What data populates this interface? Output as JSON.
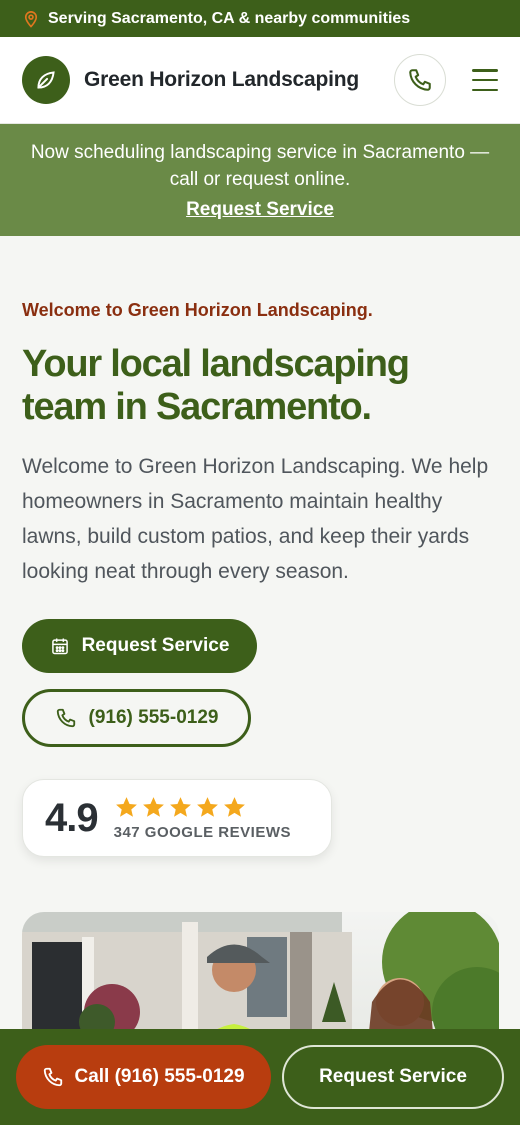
{
  "topbar": {
    "location_text": "Serving Sacramento, CA & nearby communities"
  },
  "header": {
    "brand": "Green Horizon Landscaping"
  },
  "announcement": {
    "text": "Now scheduling landscaping service in Sacramento — call or request online.",
    "link_label": "Request Service"
  },
  "hero": {
    "eyebrow": "Welcome to Green Horizon Landscaping.",
    "headline": "Your local landscaping team in Sacramento.",
    "lede": "Welcome to Green Horizon Landscaping. We help homeowners in Sacramento maintain healthy lawns, build custom patios, and keep their yards looking neat through every season.",
    "primary_cta": "Request Service",
    "phone_cta": "(916) 555-0129"
  },
  "rating": {
    "score": "4.9",
    "stars": 5,
    "count_label": "347 GOOGLE REVIEWS"
  },
  "sticky_bar": {
    "call_label": "Call (916) 555-0129",
    "request_label": "Request Service"
  },
  "colors": {
    "brand_green": "#3d5f1a",
    "accent_orange": "#b83d0f",
    "banner_green": "#6a8a47",
    "star": "#f4a81d"
  }
}
